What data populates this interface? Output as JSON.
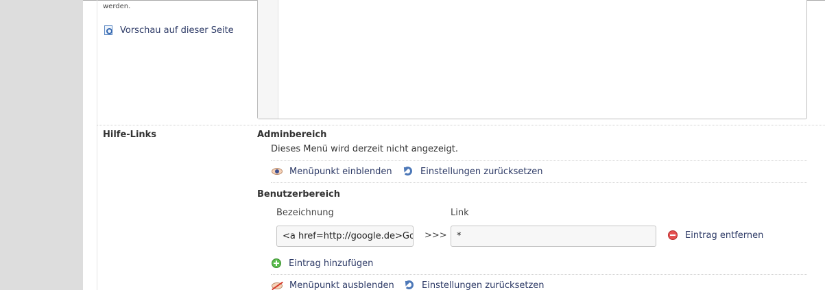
{
  "top": {
    "note_text": "werden.",
    "preview_label": "Vorschau auf dieser Seite"
  },
  "help_links": {
    "section_label": "Hilfe-Links",
    "admin": {
      "heading": "Adminbereich",
      "status_text": "Dieses Menü wird derzeit nicht angezeigt.",
      "show_label": "Menüpunkt einblenden",
      "reset_label": "Einstellungen zurücksetzen"
    },
    "user": {
      "heading": "Benutzerbereich",
      "col_name_label": "Bezeichnung",
      "col_link_label": "Link",
      "entry": {
        "name_value": "<a href=http://google.de>Google</a>",
        "separator": ">>>",
        "link_value": "*",
        "remove_label": "Eintrag entfernen"
      },
      "add_label": "Eintrag hinzufügen",
      "hide_label": "Menüpunkt ausblenden",
      "reset_label": "Einstellungen zurücksetzen"
    }
  },
  "icons": {
    "preview": "document-preview-icon",
    "show": "eye-icon",
    "reset": "reset-icon",
    "remove": "minus-circle-icon",
    "add": "plus-circle-icon",
    "hide": "eye-off-icon"
  }
}
